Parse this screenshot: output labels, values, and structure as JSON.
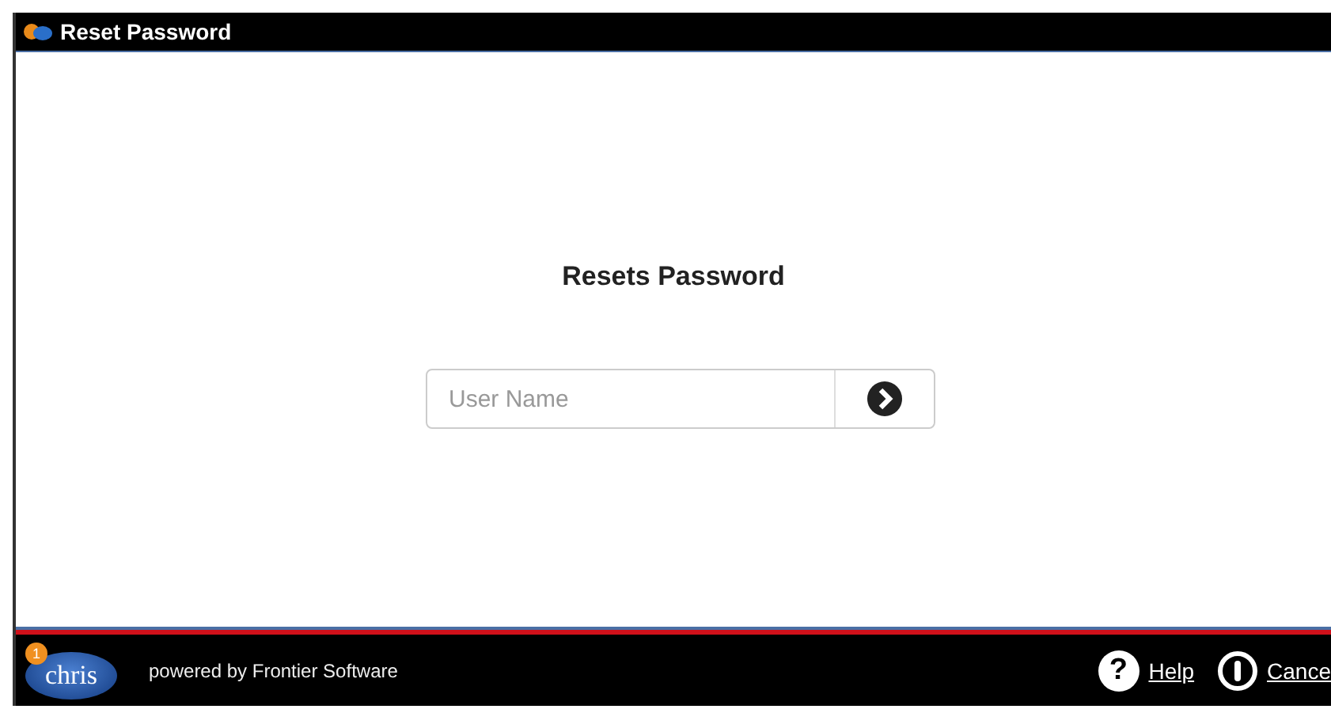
{
  "window": {
    "title": "Reset Password"
  },
  "heading": "Resets Password",
  "username": {
    "placeholder": "User Name"
  },
  "footer": {
    "logo_text": "chris",
    "logo_badge": "1",
    "powered_by": "powered by Frontier Software",
    "links": [
      {
        "kind": "help",
        "label": "Help",
        "glyph": "?"
      },
      {
        "kind": "cancel",
        "label": "Cance"
      }
    ]
  }
}
